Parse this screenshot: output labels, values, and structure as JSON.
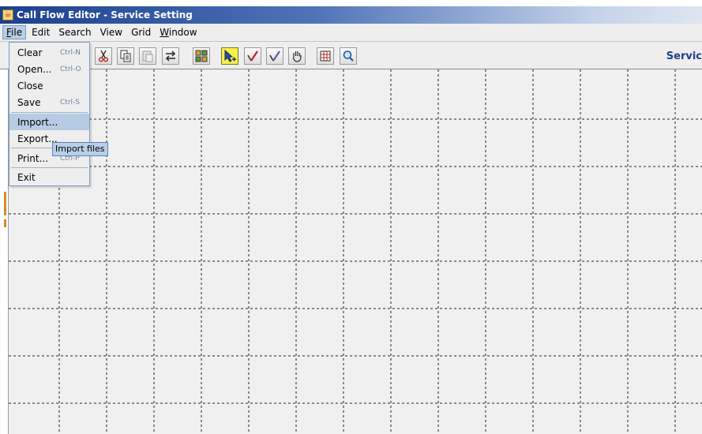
{
  "window": {
    "title": "Call Flow Editor - Service Setting"
  },
  "menubar": {
    "items": [
      {
        "label": "File",
        "active": true
      },
      {
        "label": "Edit"
      },
      {
        "label": "Search"
      },
      {
        "label": "View"
      },
      {
        "label": "Grid"
      },
      {
        "label": "Window"
      }
    ]
  },
  "toolbar": {
    "buttons": [
      {
        "icon": "cut-icon"
      },
      {
        "icon": "copy-icon"
      },
      {
        "icon": "paste-icon"
      },
      {
        "icon": "swap-icon"
      },
      {
        "icon": "compile-icon"
      },
      {
        "icon": "select-pointer-icon",
        "selected": true
      },
      {
        "icon": "draw-link-icon"
      },
      {
        "icon": "edit-pencil-icon"
      },
      {
        "icon": "pan-hand-icon"
      },
      {
        "icon": "grid-icon"
      },
      {
        "icon": "zoom-icon"
      }
    ],
    "right_label": "Servic"
  },
  "file_menu": {
    "items": [
      {
        "label": "Clear",
        "shortcut": "Ctrl-N"
      },
      {
        "label": "Open...",
        "shortcut": "Ctrl-O"
      },
      {
        "label": "Close",
        "shortcut": ""
      },
      {
        "label": "Save",
        "shortcut": "Ctrl-S"
      },
      {
        "label": "Import...",
        "shortcut": "",
        "hover": true
      },
      {
        "label": "Export...",
        "shortcut": ""
      },
      {
        "label": "Print...",
        "shortcut": "Ctrl-P"
      },
      {
        "label": "Exit",
        "shortcut": ""
      }
    ]
  },
  "tooltip": {
    "text": "Import files"
  },
  "colors": {
    "title_gradient_start": "#1a3f8f",
    "menu_highlight": "#b6cce3",
    "canvas_bg": "#f0f0f0",
    "toolbar_label": "#1f3f86"
  }
}
